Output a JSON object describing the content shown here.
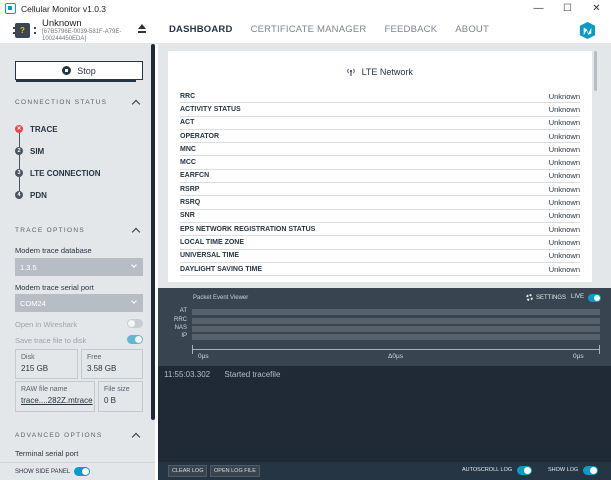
{
  "window": {
    "title": "Cellular Monitor v1.0.3",
    "controls": [
      "—",
      "☐",
      "✕"
    ]
  },
  "device": {
    "name": "Unknown",
    "serial": "[67B5796E-0039-581F-A79E-100244450EDA]",
    "icon_glyph": "?"
  },
  "nav": {
    "tabs": [
      {
        "label": "DASHBOARD",
        "active": true
      },
      {
        "label": "CERTIFICATE MANAGER",
        "active": false
      },
      {
        "label": "FEEDBACK",
        "active": false
      },
      {
        "label": "ABOUT",
        "active": false
      }
    ]
  },
  "sidebar": {
    "stop_label": "Stop",
    "connection_status_title": "CONNECTION STATUS",
    "steps": [
      {
        "num": "✕",
        "label": "TRACE",
        "status": "error"
      },
      {
        "num": "2",
        "label": "SIM",
        "status": "pending"
      },
      {
        "num": "3",
        "label": "LTE CONNECTION",
        "status": "pending"
      },
      {
        "num": "4",
        "label": "PDN",
        "status": "pending"
      }
    ],
    "trace_options_title": "TRACE OPTIONS",
    "trace_db_label": "Modem trace database",
    "trace_db_value": "1.3.5",
    "serial_port_label": "Modem trace serial port",
    "serial_port_value": "COM24",
    "open_wireshark_label": "Open in Wireshark",
    "open_wireshark_on": false,
    "save_trace_label": "Save trace file to disk",
    "save_trace_on": true,
    "disk_label": "Disk",
    "disk_value": "215 GB",
    "free_label": "Free",
    "free_value": "3.58 GB",
    "raw_file_label": "RAW file name",
    "raw_file_value": "trace....282Z.mtrace",
    "file_size_label": "File size",
    "file_size_value": "0 B",
    "advanced_options_title": "ADVANCED OPTIONS",
    "terminal_port_label": "Terminal serial port",
    "show_side_panel_label": "SHOW SIDE PANEL",
    "show_side_panel_on": true
  },
  "lte": {
    "title": "LTE Network",
    "rows": [
      {
        "key": "RRC",
        "value": "Unknown"
      },
      {
        "key": "ACTIVITY STATUS",
        "value": "Unknown"
      },
      {
        "key": "ACT",
        "value": "Unknown"
      },
      {
        "key": "OPERATOR",
        "value": "Unknown"
      },
      {
        "key": "MNC",
        "value": "Unknown"
      },
      {
        "key": "MCC",
        "value": "Unknown"
      },
      {
        "key": "EARFCN",
        "value": "Unknown"
      },
      {
        "key": "RSRP",
        "value": "Unknown"
      },
      {
        "key": "RSRQ",
        "value": "Unknown"
      },
      {
        "key": "SNR",
        "value": "Unknown"
      },
      {
        "key": "EPS NETWORK REGISTRATION STATUS",
        "value": "Unknown"
      },
      {
        "key": "LOCAL TIME ZONE",
        "value": "Unknown"
      },
      {
        "key": "UNIVERSAL TIME",
        "value": "Unknown"
      },
      {
        "key": "DAYLIGHT SAVING TIME",
        "value": "Unknown"
      }
    ]
  },
  "packet_viewer": {
    "title": "Packet Event Viewer",
    "settings_label": "SETTINGS",
    "live_label": "LIVE",
    "live_on": true,
    "lanes": [
      "AT",
      "RRC",
      "NAS",
      "IP"
    ],
    "axis_start": "0µs",
    "axis_mid": "Δ0µs",
    "axis_end": "0µs"
  },
  "log": {
    "entries": [
      {
        "time": "11:55:03.302",
        "message": "Started tracefile"
      }
    ],
    "clear_label": "CLEAR LOG",
    "open_label": "OPEN LOG FILE",
    "autoscroll_label": "AUTOSCROLL LOG",
    "autoscroll_on": true,
    "show_log_label": "SHOW LOG",
    "show_log_on": true
  },
  "colors": {
    "accent": "#0a9cc7",
    "error": "#e9474b",
    "dark": "#263544",
    "panel": "#e4e7ea"
  }
}
